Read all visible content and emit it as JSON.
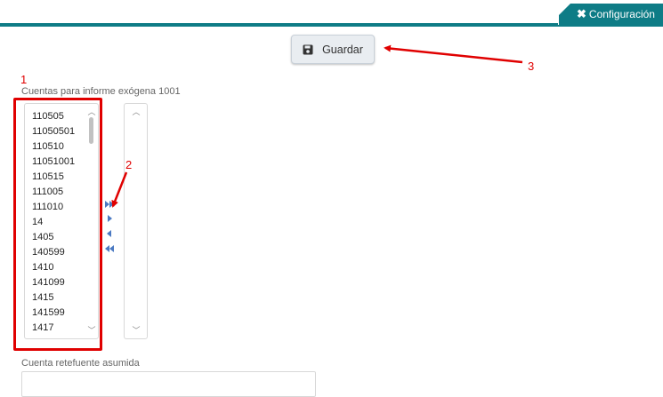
{
  "header": {
    "config_label": "Configuración",
    "accent_color": "#0e7c86"
  },
  "toolbar": {
    "save_label": "Guardar",
    "save_icon": "floppy-disk-icon"
  },
  "accounts_field": {
    "label": "Cuentas para informe exógena 1001",
    "available_items": [
      "110505",
      "11050501",
      "110510",
      "11051001",
      "110515",
      "111005",
      "111010",
      "14",
      "1405",
      "140599",
      "1410",
      "141099",
      "1415",
      "141599",
      "1417"
    ],
    "selected_items": []
  },
  "transfer_controls": [
    "move-all-right-icon",
    "move-right-icon",
    "move-left-icon",
    "move-all-left-icon"
  ],
  "retefuente_field": {
    "label": "Cuenta retefuente asumida",
    "value": ""
  },
  "annotations": {
    "box_label": "1",
    "arrow_2_label": "2",
    "arrow_3_label": "3",
    "color": "#e00000"
  }
}
